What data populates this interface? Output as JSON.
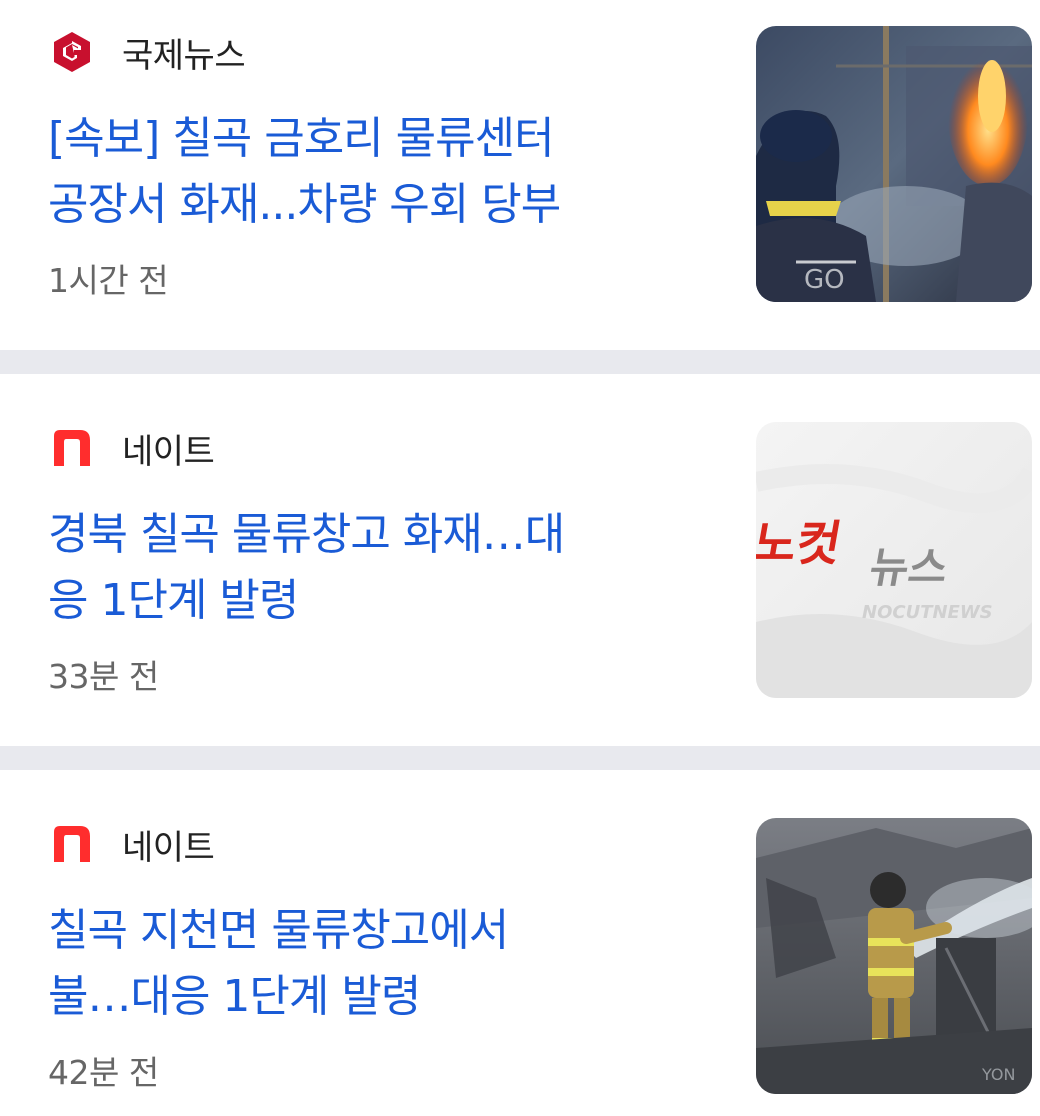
{
  "articles": [
    {
      "source": "국제뉴스",
      "source_logo": "gukje-news-g-logo",
      "headline_line1": "[속보] 칠곡 금호리 물류센터",
      "headline_line2": "공장서 화재...차량 우회 당부",
      "time": "1시간 전",
      "thumbnail": "firefighters-fire-photo"
    },
    {
      "source": "네이트",
      "source_logo": "nate-n-logo",
      "headline_line1": "경북 칠곡 물류창고 화재…대",
      "headline_line2": "응 1단계 발령",
      "time": "33분 전",
      "thumbnail": "nocutnews-logo-image",
      "thumbnail_text": {
        "brand_red": "노컷",
        "brand_gray": "뉴스",
        "brand_en": "NOCUTNEWS"
      }
    },
    {
      "source": "네이트",
      "source_logo": "nate-n-logo",
      "headline_line1": "칠곡 지천면 물류창고에서",
      "headline_line2": "불…대응 1단계 발령",
      "time": "42분 전",
      "thumbnail": "firefighter-water-hose-photo"
    }
  ],
  "colors": {
    "headline": "#1a5bd6",
    "source_text": "#222222",
    "time_text": "#666666",
    "divider": "#e8e9ee",
    "gukje_logo": "#c8102e",
    "nate_logo": "#ff2d2d"
  }
}
